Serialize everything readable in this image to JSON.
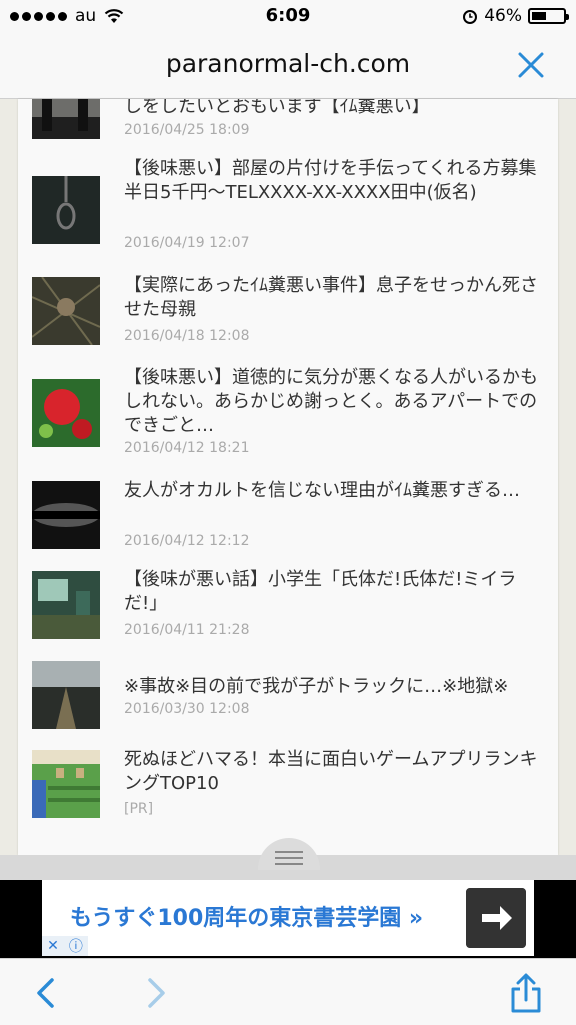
{
  "status_bar": {
    "carrier": "au",
    "time": "6:09",
    "battery_text": "46%",
    "battery_level": 0.46
  },
  "url_bar": {
    "domain": "paranormal-ch.com"
  },
  "articles": [
    {
      "title": "しをしたいとおもいます【ｲﾑ糞悪い】",
      "date": "2016/04/25 18:09",
      "thumb_icon": "silhouette-image"
    },
    {
      "title": "【後味悪い】部屋の片付けを手伝ってくれる方募集半日5千円〜TELXXXX-XX-XXXX田中(仮名)",
      "date": "2016/04/19 12:07",
      "thumb_icon": "noose-image"
    },
    {
      "title": "【実際にあったｲﾑ糞悪い事件】息子をせっかん死させた母親",
      "date": "2016/04/18 12:08",
      "thumb_icon": "forest-face-image"
    },
    {
      "title": "【後味悪い】道徳的に気分が悪くなる人がいるかもしれない。あらかじめ謝っとく。あるアパートでのできごと…",
      "date": "2016/04/12 18:21",
      "thumb_icon": "red-flower-image"
    },
    {
      "title": "友人がオカルトを信じない理由がｲﾑ糞悪すぎる…",
      "date": "2016/04/12 12:12",
      "thumb_icon": "dark-cloud-image"
    },
    {
      "title": "【後味が悪い話】小学生「氏体だ!氏体だ!ミイラだ!」",
      "date": "2016/04/11 21:28",
      "thumb_icon": "classroom-image"
    },
    {
      "title": "※事故※目の前で我が子がトラックに…※地獄※",
      "date": "2016/03/30 12:08",
      "thumb_icon": "road-image"
    },
    {
      "title": "死ぬほどハマる！本当に面白いゲームアプリランキングTOP10",
      "date": "[PR]",
      "thumb_icon": "pixel-game-image"
    }
  ],
  "ad": {
    "text": "もうすぐ100周年の東京書芸学園 »",
    "arrow_icon": "arrow-right-icon",
    "close_glyph": "✕",
    "info_glyph": "ⓘ"
  },
  "toolbar": {
    "back_icon": "chevron-left-icon",
    "forward_icon": "chevron-right-icon",
    "share_icon": "share-icon"
  },
  "colors": {
    "accent": "#2a8bd6",
    "date": "#aaaaaa",
    "title": "#333333"
  }
}
